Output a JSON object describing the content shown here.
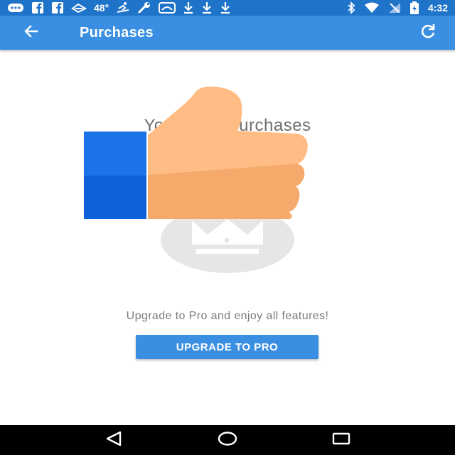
{
  "status_bar": {
    "temperature": "48°",
    "time": "4:32",
    "left_icons": [
      "message-icon",
      "facebook-icon",
      "facebook-icon",
      "weather-icon",
      "temperature-text",
      "skier-icon",
      "wrench-icon",
      "app-icon",
      "download-icon",
      "download-icon",
      "download-icon"
    ],
    "right_icons": [
      "bluetooth-icon",
      "wifi-icon",
      "signal-icon",
      "battery-icon"
    ]
  },
  "app_bar": {
    "title": "Purchases",
    "back_icon": "arrow-left-icon",
    "refresh_icon": "refresh-icon",
    "color": "#3a8fe2"
  },
  "content": {
    "empty_title": "You ha      purchases",
    "empty_illustration": "crown-icon",
    "overlay_image": "thumbs-up-icon",
    "upgrade_text": "Upgrade to Pro and enjoy all features!",
    "upgrade_button_label": "UPGRADE TO PRO"
  },
  "nav_bar": {
    "items": [
      "back-triangle-icon",
      "home-circle-icon",
      "recents-square-icon"
    ]
  }
}
